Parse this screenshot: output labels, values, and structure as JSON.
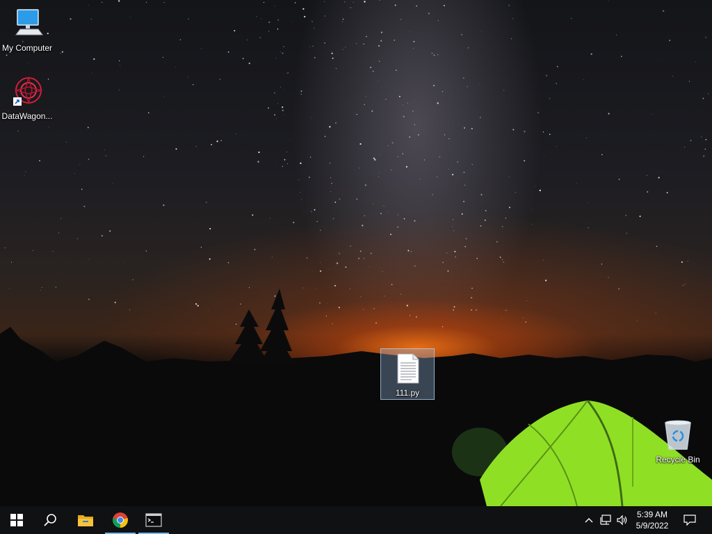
{
  "desktop": {
    "icons": {
      "my_computer": "My Computer",
      "datawagon": "DataWagon...",
      "file_111": "111.py",
      "recycle_bin": "Recycle Bin"
    }
  },
  "taskbar": {
    "start": "start-icon",
    "search": "search-icon",
    "apps": [
      "file-explorer-icon",
      "chrome-icon",
      "terminal-icon"
    ],
    "tray": [
      "chevron-up-icon",
      "network-icon",
      "volume-icon"
    ],
    "time": "5:39 AM",
    "date": "5/9/2022",
    "notifications": "action-center-icon"
  },
  "colors": {
    "taskbar_bg": "#101113",
    "active_underline": "#76b9ed",
    "tent_green": "#8fe025"
  }
}
